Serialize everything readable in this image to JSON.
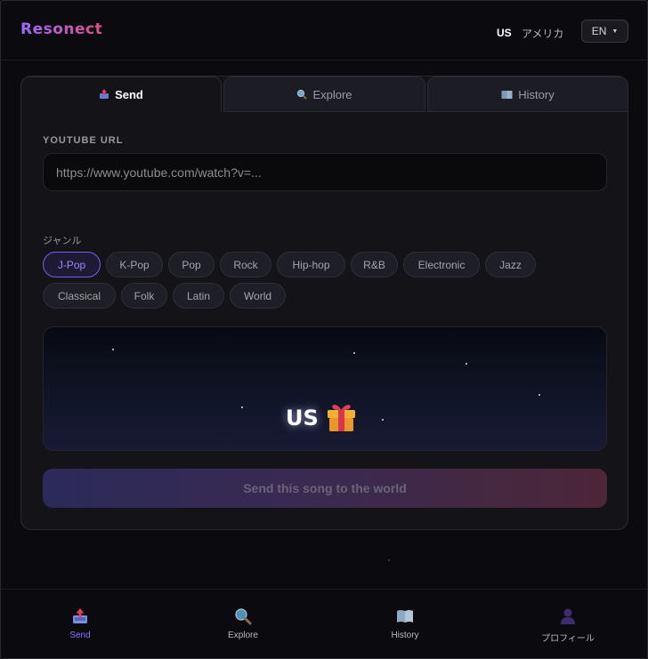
{
  "header": {
    "logo": "Resonect",
    "location_code": "US",
    "location_name": "アメリカ",
    "language": "EN"
  },
  "tabs": [
    {
      "label": "Send",
      "icon": "outbox-tray-icon",
      "active": true
    },
    {
      "label": "Explore",
      "icon": "magnifier-icon",
      "active": false
    },
    {
      "label": "History",
      "icon": "book-icon",
      "active": false
    }
  ],
  "form": {
    "url_label": "YOUTUBE URL",
    "url_value": "",
    "url_placeholder": "https://www.youtube.com/watch?v=...",
    "genre_label": "ジャンル",
    "genres": [
      "J-Pop",
      "K-Pop",
      "Pop",
      "Rock",
      "Hip-hop",
      "R&B",
      "Electronic",
      "Jazz",
      "Classical",
      "Folk",
      "Latin",
      "World"
    ],
    "selected_genre": "J-Pop"
  },
  "preview": {
    "country_code": "US",
    "icon": "gift-icon"
  },
  "send_button": "Send this song to the world",
  "bottom_nav": [
    {
      "label": "Send",
      "icon": "outbox-tray-icon",
      "active": true
    },
    {
      "label": "Explore",
      "icon": "magnifier-icon",
      "active": false
    },
    {
      "label": "History",
      "icon": "book-icon",
      "active": false
    },
    {
      "label": "プロフィール",
      "icon": "user-silhouette-icon",
      "active": false
    }
  ],
  "colors": {
    "accent": "#8d6cff",
    "background": "#0b0b0f",
    "card": "#131318"
  }
}
